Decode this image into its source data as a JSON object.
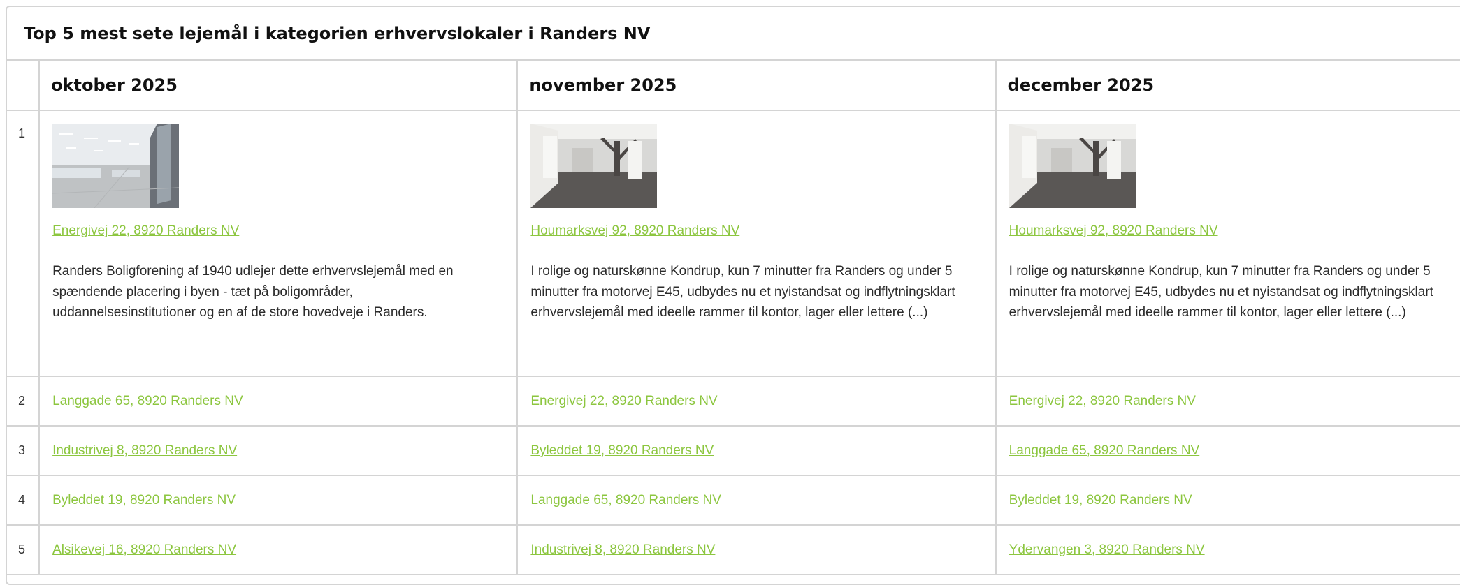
{
  "title": "Top 5 mest sete lejemål i kategorien erhvervslokaler i Randers NV",
  "columns": [
    "oktober 2025",
    "november 2025",
    "december 2025"
  ],
  "colors": {
    "link": "#8cc63f",
    "border": "#d4d4d4"
  },
  "top": [
    {
      "image": "store-interior-photo",
      "address": "Energivej 22, 8920 Randers NV",
      "description": "Randers Boligforening af 1940 udlejer dette erhvervslejemål med en spændende placering i byen - tæt på boligområder, uddannelsesinstitutioner og en af de store hovedveje i Randers."
    },
    {
      "image": "empty-hall-photo",
      "address": "Houmarksvej 92, 8920 Randers NV",
      "description": "I rolige og naturskønne Kondrup, kun 7 minutter fra Randers og under 5 minutter fra motorvej E45, udbydes nu et nyistandsat og indflytningsklart erhvervslejemål med ideelle rammer til kontor, lager eller lettere (...)"
    },
    {
      "image": "empty-hall-photo",
      "address": "Houmarksvej 92, 8920 Randers NV",
      "description": "I rolige og naturskønne Kondrup, kun 7 minutter fra Randers og under 5 minutter fra motorvej E45, udbydes nu et nyistandsat og indflytningsklart erhvervslejemål med ideelle rammer til kontor, lager eller lettere (...)"
    }
  ],
  "ranks": [
    "1",
    "2",
    "3",
    "4",
    "5"
  ],
  "rows": [
    [
      "Langgade 65, 8920 Randers NV",
      "Energivej 22, 8920 Randers NV",
      "Energivej 22, 8920 Randers NV"
    ],
    [
      "Industrivej 8, 8920 Randers NV",
      "Byleddet 19, 8920 Randers NV",
      "Langgade 65, 8920 Randers NV"
    ],
    [
      "Byleddet 19, 8920 Randers NV",
      "Langgade 65, 8920 Randers NV",
      "Byleddet 19, 8920 Randers NV"
    ],
    [
      "Alsikevej 16, 8920 Randers NV",
      "Industrivej 8, 8920 Randers NV",
      "Ydervangen 3, 8920 Randers NV"
    ]
  ]
}
